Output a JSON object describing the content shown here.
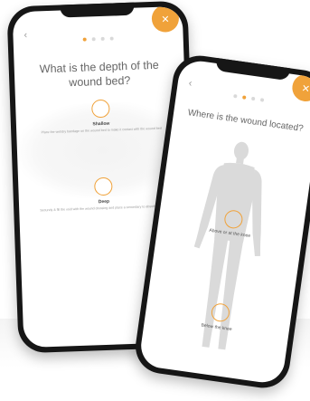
{
  "colors": {
    "accent": "#f0a23a",
    "phone_frame": "#161616",
    "silhouette": "#dadada"
  },
  "back_phone": {
    "question": "What is the depth of the wound bed?",
    "step_dots": 4,
    "options": [
      {
        "label": "Shallow",
        "description": "Place the wet/dry bandage on the wound bed to make it contact with the wound bed"
      },
      {
        "label": "Deep",
        "description": "Securely & fill the void with the wound dressing and place a secondary to absorb exudate"
      }
    ]
  },
  "front_phone": {
    "question": "Where is the wound located?",
    "step_dots": 4,
    "options": [
      {
        "label": "Above or at the knee"
      },
      {
        "label": "Below the knee"
      }
    ]
  }
}
